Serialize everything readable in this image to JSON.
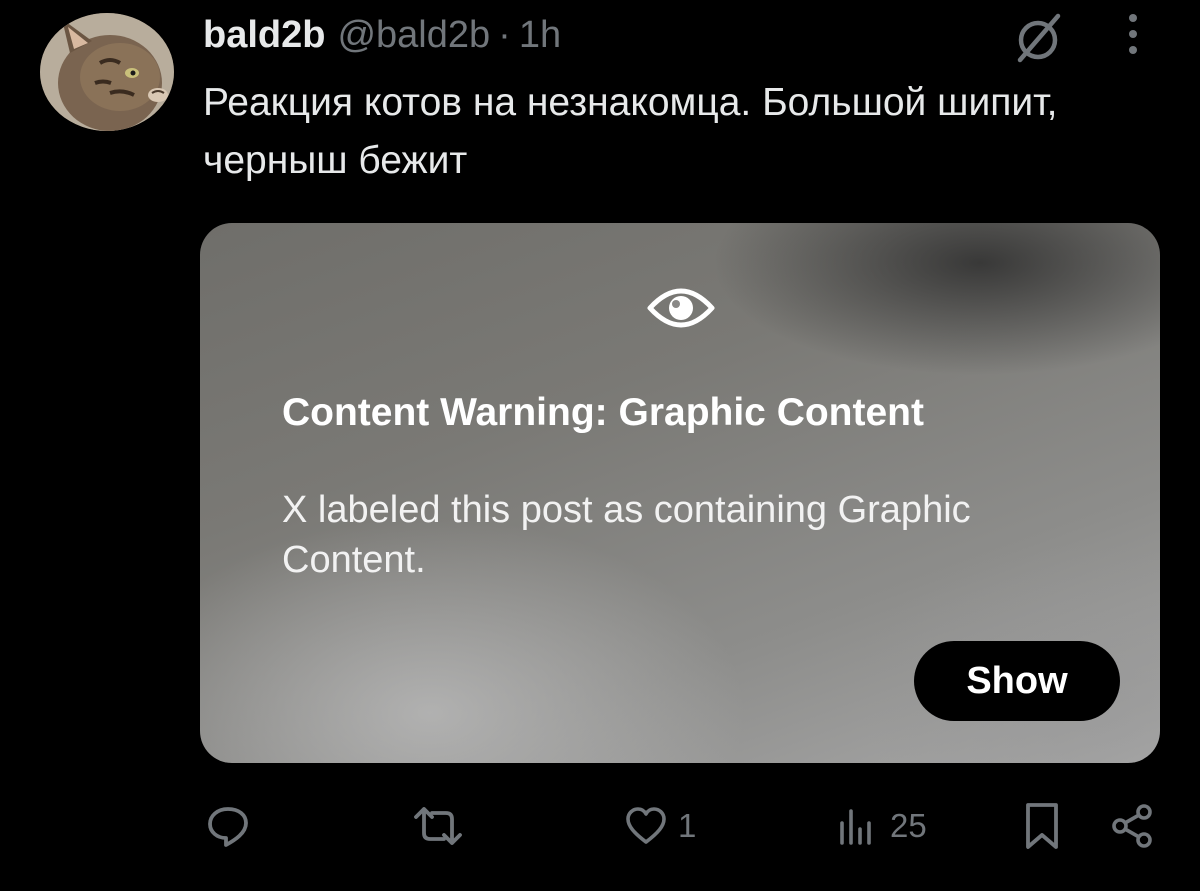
{
  "post": {
    "author": {
      "display_name": "bald2b",
      "handle": "@bald2b",
      "separator": "·",
      "time": "1h",
      "avatar_icon": "cat-avatar"
    },
    "text": "Реакция котов на незнакомца. Большой шипит, черныш бежит",
    "header_icons": [
      "grok-icon",
      "more-icon"
    ]
  },
  "content_warning": {
    "icon": "eye-icon",
    "title": "Content Warning: Graphic Content",
    "body": "X labeled this post as containing Graphic Content.",
    "button_label": "Show"
  },
  "actions": {
    "reply": {
      "icon": "reply-icon",
      "count": ""
    },
    "repost": {
      "icon": "repost-icon",
      "count": ""
    },
    "like": {
      "icon": "heart-icon",
      "count": "1"
    },
    "views": {
      "icon": "views-icon",
      "count": "25"
    },
    "bookmark": {
      "icon": "bookmark-icon"
    },
    "share": {
      "icon": "share-icon"
    }
  },
  "colors": {
    "background": "#000000",
    "text_primary": "#e7e9ea",
    "text_secondary": "#71767b",
    "button_bg": "#000000"
  }
}
